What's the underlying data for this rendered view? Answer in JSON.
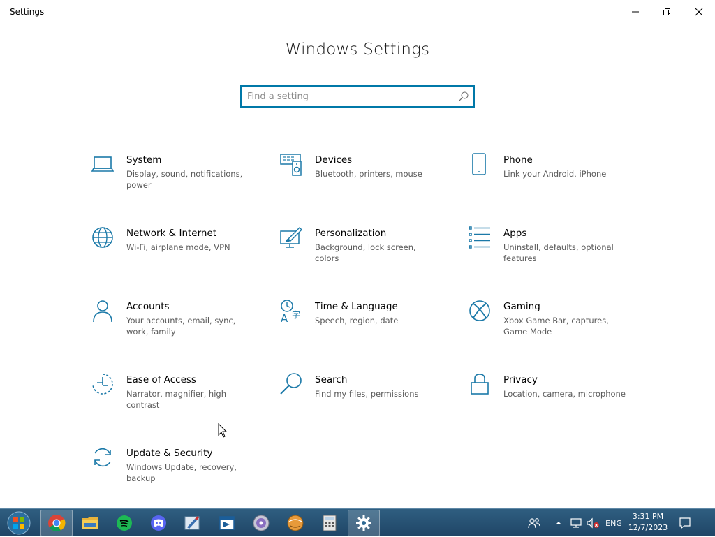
{
  "window": {
    "title": "Settings"
  },
  "page": {
    "title": "Windows Settings"
  },
  "search": {
    "placeholder": "Find a setting",
    "value": ""
  },
  "categories": [
    {
      "name": "System",
      "desc": "Display, sound, notifications, power",
      "icon": "laptop-icon"
    },
    {
      "name": "Devices",
      "desc": "Bluetooth, printers, mouse",
      "icon": "devices-icon"
    },
    {
      "name": "Phone",
      "desc": "Link your Android, iPhone",
      "icon": "phone-icon"
    },
    {
      "name": "Network & Internet",
      "desc": "Wi-Fi, airplane mode, VPN",
      "icon": "globe-icon"
    },
    {
      "name": "Personalization",
      "desc": "Background, lock screen, colors",
      "icon": "personalization-icon"
    },
    {
      "name": "Apps",
      "desc": "Uninstall, defaults, optional features",
      "icon": "apps-list-icon"
    },
    {
      "name": "Accounts",
      "desc": "Your accounts, email, sync, work, family",
      "icon": "person-icon"
    },
    {
      "name": "Time & Language",
      "desc": "Speech, region, date",
      "icon": "time-language-icon"
    },
    {
      "name": "Gaming",
      "desc": "Xbox Game Bar, captures, Game Mode",
      "icon": "xbox-icon"
    },
    {
      "name": "Ease of Access",
      "desc": "Narrator, magnifier, high contrast",
      "icon": "ease-of-access-icon"
    },
    {
      "name": "Search",
      "desc": "Find my files, permissions",
      "icon": "magnifier-icon"
    },
    {
      "name": "Privacy",
      "desc": "Location, camera, microphone",
      "icon": "lock-icon"
    },
    {
      "name": "Update & Security",
      "desc": "Windows Update, recovery, backup",
      "icon": "sync-arrows-icon"
    }
  ],
  "taskbar": {
    "apps": [
      "chrome",
      "file-explorer",
      "spotify",
      "discord",
      "paint",
      "remote-desktop",
      "media-player",
      "vlc-like",
      "calculator",
      "settings"
    ],
    "active": "settings",
    "language": "ENG",
    "time": "3:31 PM",
    "date": "12/7/2023"
  },
  "colors": {
    "accent": "#0078a8",
    "icon": "#1b79a8",
    "taskbar": "#254d6e"
  }
}
